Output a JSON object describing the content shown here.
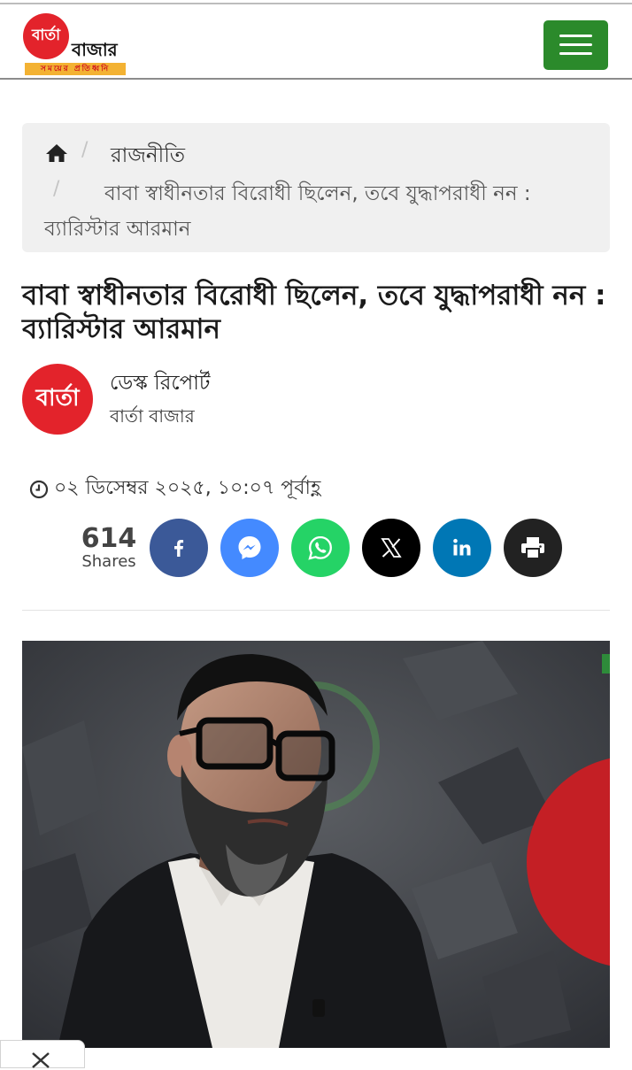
{
  "site": {
    "logo_badge": "বার্তা",
    "logo_text": "বাজার",
    "logo_tagline": "সময়ের প্রতিধ্বনি"
  },
  "nav": {
    "menu_icon": "hamburger-icon"
  },
  "breadcrumb": {
    "home_icon": "home-icon",
    "separator": "/",
    "category": "রাজনীতি",
    "current": "বাবা স্বাধীনতার বিরোধী ছিলেন, তবে যুদ্ধাপরাধী নন : ব্যারিস্টার আরমান"
  },
  "article": {
    "title": "বাবা স্বাধীনতার বিরোধী ছিলেন, তবে যুদ্ধাপরাধী নন : ব্যারিস্টার আরমান",
    "author_avatar_text": "বার্তা",
    "author_name": "ডেস্ক রিপোর্ট",
    "author_org": "বার্তা বাজার",
    "date": "০২ ডিসেম্বর ২০২৫, ১০:০৭ পূর্বাহ্ণ"
  },
  "share": {
    "count": "614",
    "label": "Shares",
    "buttons": [
      {
        "name": "facebook",
        "icon": "facebook-icon",
        "color": "#3b5998"
      },
      {
        "name": "messenger",
        "icon": "messenger-icon",
        "color": "#448aff"
      },
      {
        "name": "whatsapp",
        "icon": "whatsapp-icon",
        "color": "#25d366"
      },
      {
        "name": "x",
        "icon": "x-icon",
        "color": "#000000"
      },
      {
        "name": "linkedin",
        "icon": "linkedin-icon",
        "color": "#0077b5"
      },
      {
        "name": "print",
        "icon": "print-icon",
        "color": "#222222"
      }
    ]
  },
  "colors": {
    "brand_red": "#e3232b",
    "menu_green": "#2b8a2b",
    "tagline_yellow": "#f3b233"
  }
}
